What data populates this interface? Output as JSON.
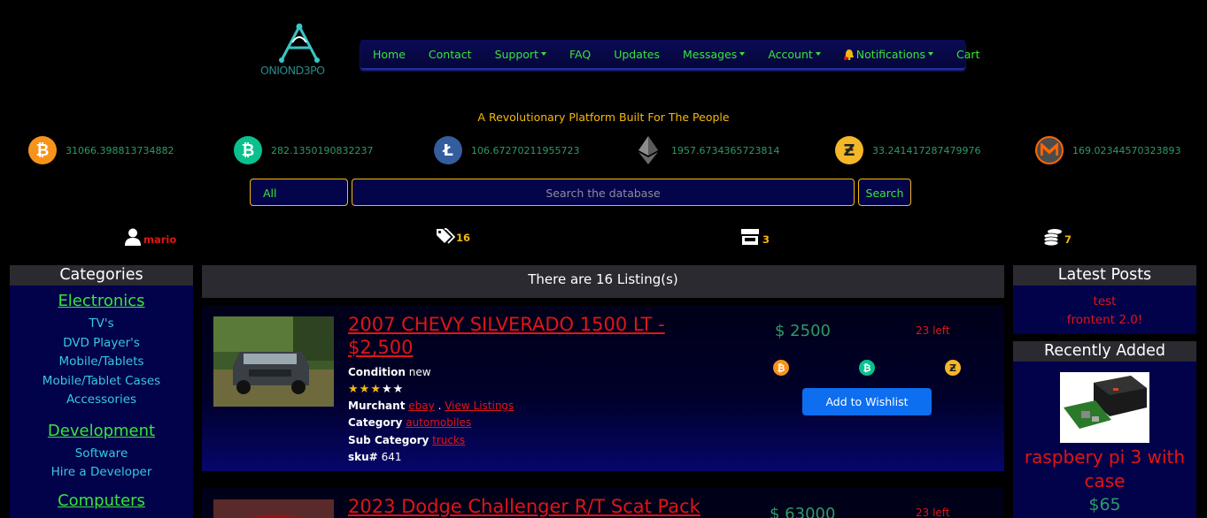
{
  "brand": {
    "logo_text": "ONIOND3PO"
  },
  "nav": {
    "items": [
      {
        "label": "Home",
        "dropdown": false
      },
      {
        "label": "Contact",
        "dropdown": false
      },
      {
        "label": "Support",
        "dropdown": true
      },
      {
        "label": "FAQ",
        "dropdown": false
      },
      {
        "label": "Updates",
        "dropdown": false
      },
      {
        "label": "Messages",
        "dropdown": true
      },
      {
        "label": "Account",
        "dropdown": true
      },
      {
        "label": "Notifications",
        "dropdown": true,
        "icon": "bell-icon"
      },
      {
        "label": "Cart",
        "dropdown": false
      }
    ]
  },
  "tagline": "A Revolutionary Platform Built For The People",
  "ticker": [
    {
      "coin": "bitcoin",
      "icon": "bitcoin-icon",
      "color": "#f7931a",
      "value": "31066.398813734882"
    },
    {
      "coin": "bitcoin-cash",
      "icon": "bitcoin-cash-icon",
      "color": "#0ac18e",
      "value": "282.1350190832237"
    },
    {
      "coin": "litecoin",
      "icon": "litecoin-icon",
      "color": "#345d9d",
      "value": "106.67270211955723"
    },
    {
      "coin": "ethereum",
      "icon": "ethereum-icon",
      "color": "#8c8c8c",
      "value": "1957.6734365723814"
    },
    {
      "coin": "zcash",
      "icon": "zcash-icon",
      "color": "#f4b728",
      "value": "33.241417287479976"
    },
    {
      "coin": "monero",
      "icon": "monero-icon",
      "color": "#ff6600",
      "value": "169.02344570323893"
    }
  ],
  "search": {
    "category": "All",
    "placeholder": "Search the database",
    "button": "Search"
  },
  "stats": {
    "user": "mario",
    "tags": "16",
    "stores": "3",
    "coins": "7"
  },
  "sidebar": {
    "title": "Categories",
    "groups": [
      {
        "name": "Electronics",
        "items": [
          "TV's",
          "DVD Player's",
          "Mobile/Tablets",
          "Mobile/Tablet Cases",
          "Accessories"
        ]
      },
      {
        "name": "Development",
        "items": [
          "Software",
          "Hire a Developer"
        ]
      },
      {
        "name": "Computers",
        "items": []
      }
    ]
  },
  "main": {
    "listing_count": "There are 16 Listing(s)",
    "listings": [
      {
        "title_line1": "2007 CHEVY SILVERADO 1500 LT -",
        "title_line2": "$2,500",
        "condition_label": "Condition",
        "condition": "new",
        "rating": 3,
        "rating_max": 5,
        "merchant_label": "Murchant",
        "merchant": "ebay",
        "merchant_sep": ".",
        "view_listings": "View Listings",
        "category_label": "Category",
        "category": "automobiles",
        "subcategory_label": "Sub Category",
        "subcategory": "trucks",
        "sku_label": "sku#",
        "sku": "641",
        "price": "$ 2500",
        "left": "23 left",
        "wishlist": "Add to Wishlist"
      },
      {
        "title_line1": "2023 Dodge Challenger R/T Scat Pack",
        "price": "$ 63000",
        "left": "23 left"
      }
    ]
  },
  "right": {
    "latest_title": "Latest Posts",
    "posts": [
      "test",
      "frontent 2.0!"
    ],
    "recent_title": "Recently Added",
    "recent_item": "raspbery pi 3 with case",
    "recent_price": "$65"
  },
  "colors": {
    "accent_green": "#39e539",
    "nav_bg": "#0a0a55",
    "gold": "#f5b80f",
    "link_red": "#e01515",
    "teal": "#37c8e0",
    "wishlist_blue": "#0d6ef0"
  }
}
